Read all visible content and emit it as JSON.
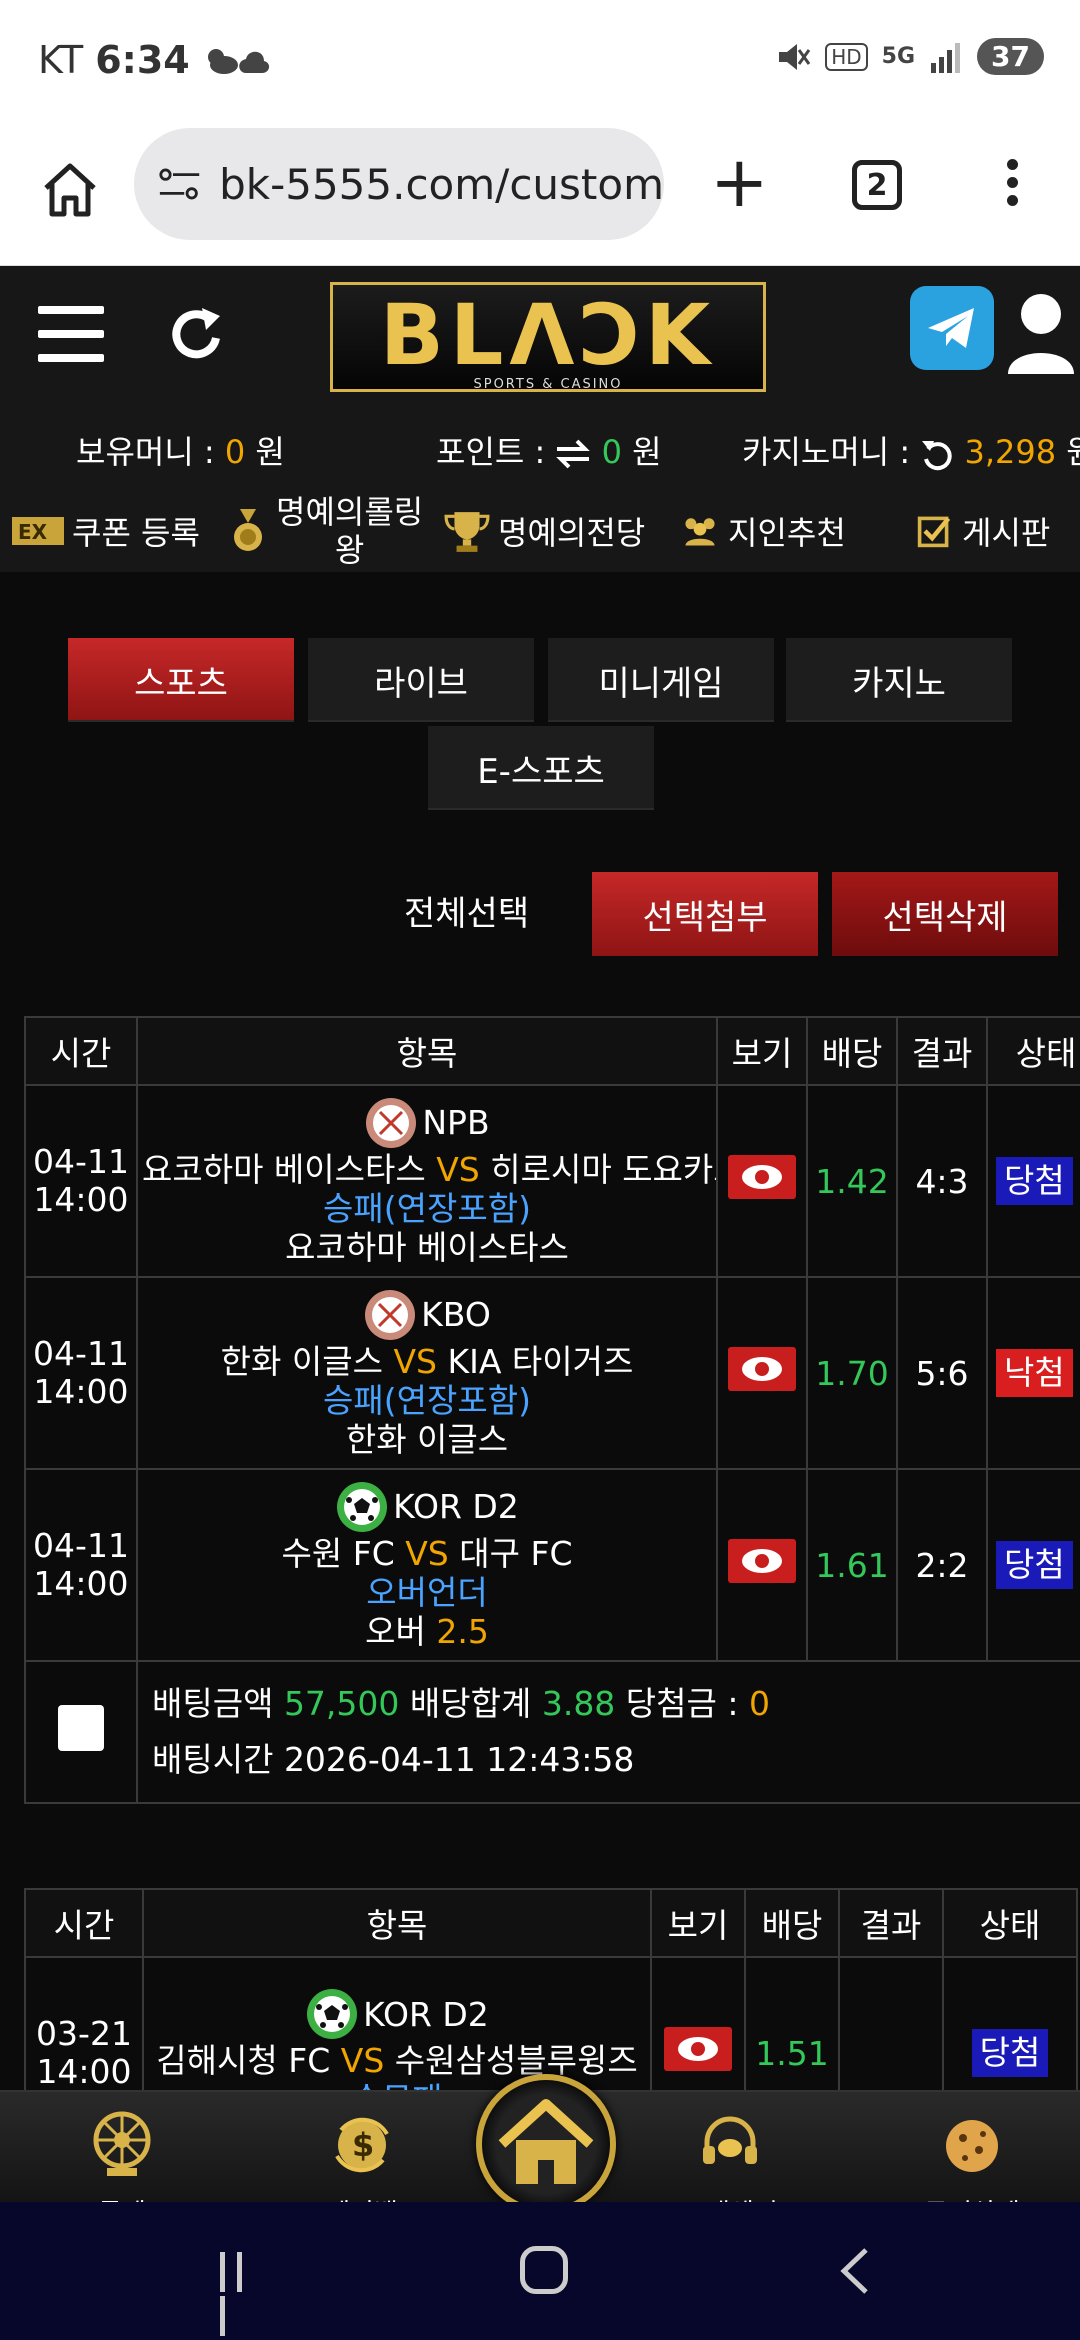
{
  "status_bar": {
    "carrier": "KT",
    "time": "6:34",
    "network": "5G",
    "battery": "37"
  },
  "browser": {
    "url": "bk-5555.com/custom",
    "tab_count": "2"
  },
  "site": {
    "logo_text": "BLΛϽK",
    "logo_sub": "SPORTS & CASINO",
    "money": {
      "holding_label": "보유머니 : ",
      "holding_value": "0",
      "holding_unit": " 원",
      "point_label": "포인트 : ",
      "point_value": "0",
      "point_unit": " 원",
      "casino_label": "카지노머니 : ",
      "casino_value": "3,298",
      "casino_unit": " 원"
    },
    "menu": {
      "coupon": "쿠폰 등록",
      "rolling_line1": "명예의롤링",
      "rolling_line2": "왕",
      "hall": "명예의전당",
      "referral": "지인추천",
      "board": "게시판"
    }
  },
  "categories": [
    "스포츠",
    "라이브",
    "미니게임",
    "카지노",
    "E-스포츠"
  ],
  "actions": {
    "select_all": "전체선택",
    "attach": "선택첨부",
    "delete": "선택삭제"
  },
  "table_headers": {
    "time": "시간",
    "item": "항목",
    "view": "보기",
    "odds": "배당",
    "result": "결과",
    "status": "상태"
  },
  "bet1": {
    "rows": [
      {
        "date": "04-11",
        "time": "14:00",
        "league": "NPB",
        "home": "요코하마 베이스타스",
        "vs": "VS",
        "away": "히로시마 도요카프",
        "market": "승패(연장포함)",
        "pick": "요코하마 베이스타스",
        "odds": "1.42",
        "result": "4:3",
        "status": "당첨"
      },
      {
        "date": "04-11",
        "time": "14:00",
        "league": "KBO",
        "home": "한화 이글스",
        "vs": "VS",
        "away": "KIA 타이거즈",
        "market": "승패(연장포함)",
        "pick": "한화 이글스",
        "odds": "1.70",
        "result": "5:6",
        "status": "낙첨"
      },
      {
        "date": "04-11",
        "time": "14:00",
        "league": "KOR D2",
        "home": "수원 FC",
        "vs": "VS",
        "away": "대구 FC",
        "market": "오버언더",
        "pick_prefix": "오버 ",
        "pick_value": "2.5",
        "odds": "1.61",
        "result": "2:2",
        "status": "당첨"
      }
    ],
    "summary": {
      "amount_label": "배팅금액 ",
      "amount": "57,500",
      "odds_label": " 배당합계 ",
      "odds_total": "3.88",
      "win_label": " 당첨금 : ",
      "win": "0",
      "time_label": "배팅시간 ",
      "time": "2026-04-11 12:43:58"
    }
  },
  "bet2": {
    "rows": [
      {
        "date": "03-21",
        "time": "14:00",
        "league": "KOR D2",
        "home": "김해시청 FC",
        "vs": "VS",
        "away": "수원삼성블루윙즈",
        "market": "승무패",
        "odds": "1.51",
        "result": "",
        "status": "당첨"
      }
    ]
  },
  "bottom_nav": {
    "roulette": "룰렛",
    "payback": "페이백",
    "support": "고객센터",
    "cookie": "쿠키삭제"
  },
  "colors": {
    "accent_red": "#c62828",
    "gold": "#e9c250",
    "win_blue": "#1a1ab8",
    "lose_red": "#d81e1e",
    "odds_green": "#34c759",
    "market_blue": "#4aa3ff",
    "vs_orange": "#f0a500"
  }
}
